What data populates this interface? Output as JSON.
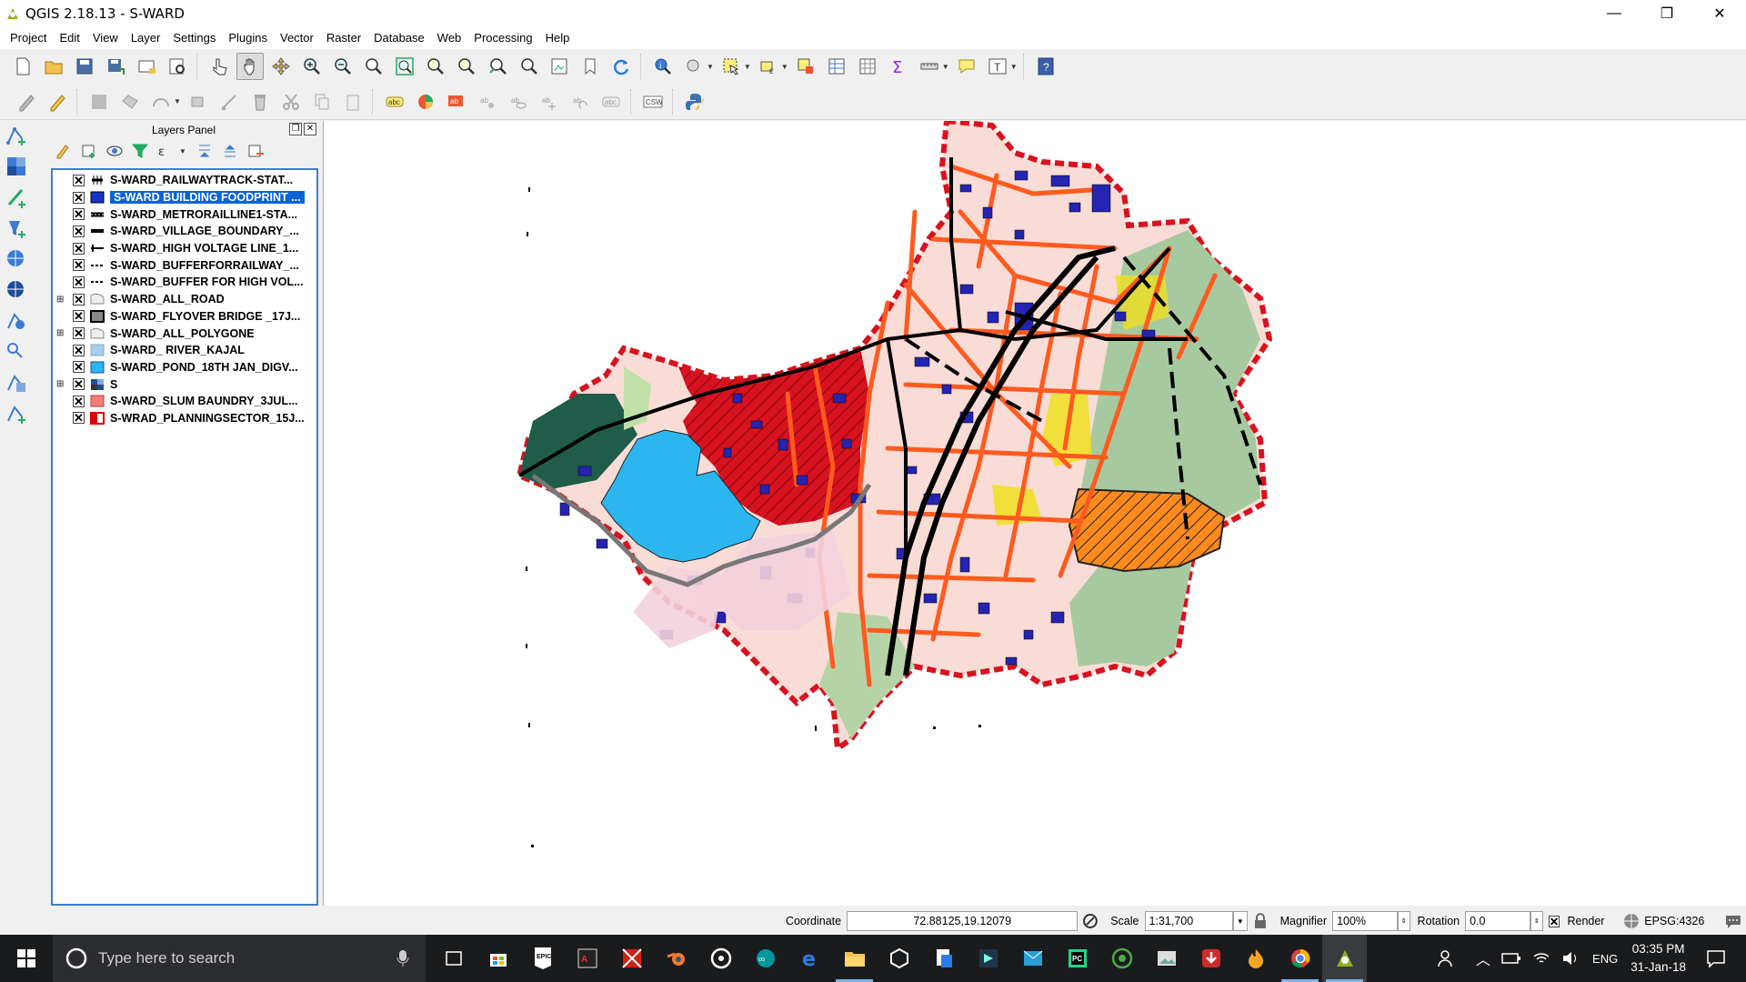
{
  "window": {
    "title": "QGIS 2.18.13 - S-WARD"
  },
  "menu": [
    "Project",
    "Edit",
    "View",
    "Layer",
    "Settings",
    "Plugins",
    "Vector",
    "Raster",
    "Database",
    "Web",
    "Processing",
    "Help"
  ],
  "layers_panel": {
    "title": "Layers Panel",
    "layers": [
      {
        "name": "S-WARD_RAILWAYTRACK-STAT...",
        "checked": true,
        "symbol": "railway",
        "expandable": false,
        "selected": false
      },
      {
        "name": "S-WARD BUILDING FOODPRINT  ...",
        "checked": true,
        "symbol": "fill-blue-dark",
        "expandable": false,
        "selected": true
      },
      {
        "name": "S-WARD_METRORAILLINE1-STA...",
        "checked": true,
        "symbol": "metro-line",
        "expandable": false,
        "selected": false
      },
      {
        "name": "S-WARD_VILLAGE_BOUNDARY_...",
        "checked": true,
        "symbol": "thick-line",
        "expandable": false,
        "selected": false
      },
      {
        "name": "S-WARD_HIGH VOLTAGE LINE_1...",
        "checked": true,
        "symbol": "hv-line",
        "expandable": false,
        "selected": false
      },
      {
        "name": "S-WARD_BUFFERFORRAILWAY_...",
        "checked": true,
        "symbol": "dash-line",
        "expandable": false,
        "selected": false
      },
      {
        "name": "S-WARD_BUFFER FOR HIGH VOL...",
        "checked": true,
        "symbol": "dash-line",
        "expandable": false,
        "selected": false
      },
      {
        "name": "S-WARD_ALL_ROAD",
        "checked": true,
        "symbol": "road-poly",
        "expandable": true,
        "selected": false
      },
      {
        "name": "S-WARD_FLYOVER BRIDGE _17J...",
        "checked": true,
        "symbol": "flyover",
        "expandable": false,
        "selected": false
      },
      {
        "name": "S-WARD_ALL_POLYGONE",
        "checked": true,
        "symbol": "road-poly",
        "expandable": true,
        "selected": false
      },
      {
        "name": "S-WARD_ RIVER_KAJAL",
        "checked": true,
        "symbol": "river",
        "expandable": false,
        "selected": false
      },
      {
        "name": "S-WARD_POND_18TH JAN_DIGV...",
        "checked": true,
        "symbol": "pond",
        "expandable": false,
        "selected": false
      },
      {
        "name": "S",
        "checked": true,
        "symbol": "raster",
        "expandable": true,
        "selected": false
      },
      {
        "name": "S-WARD_SLUM BAUNDRY_3JUL...",
        "checked": true,
        "symbol": "slum",
        "expandable": false,
        "selected": false
      },
      {
        "name": "S-WRAD_PLANNINGSECTOR_15J...",
        "checked": true,
        "symbol": "planning",
        "expandable": false,
        "selected": false
      }
    ]
  },
  "statusbar": {
    "coordinate_label": "Coordinate",
    "coordinate_value": "72.88125,19.12079",
    "scale_label": "Scale",
    "scale_value": "1:31,700",
    "magnifier_label": "Magnifier",
    "magnifier_value": "100%",
    "rotation_label": "Rotation",
    "rotation_value": "0.0",
    "render_label": "Render",
    "render_checked": true,
    "crs": "EPSG:4326"
  },
  "taskbar": {
    "search_placeholder": "Type here to search",
    "language": "ENG",
    "time": "03:35 PM",
    "date": "31-Jan-18"
  },
  "colors": {
    "selection": "#0a64d6",
    "road": "#ff5a1f",
    "slum": "#d8121f",
    "pond": "#2bb6f0",
    "buildings": "#2424b0",
    "green": "#a7c9a0"
  }
}
